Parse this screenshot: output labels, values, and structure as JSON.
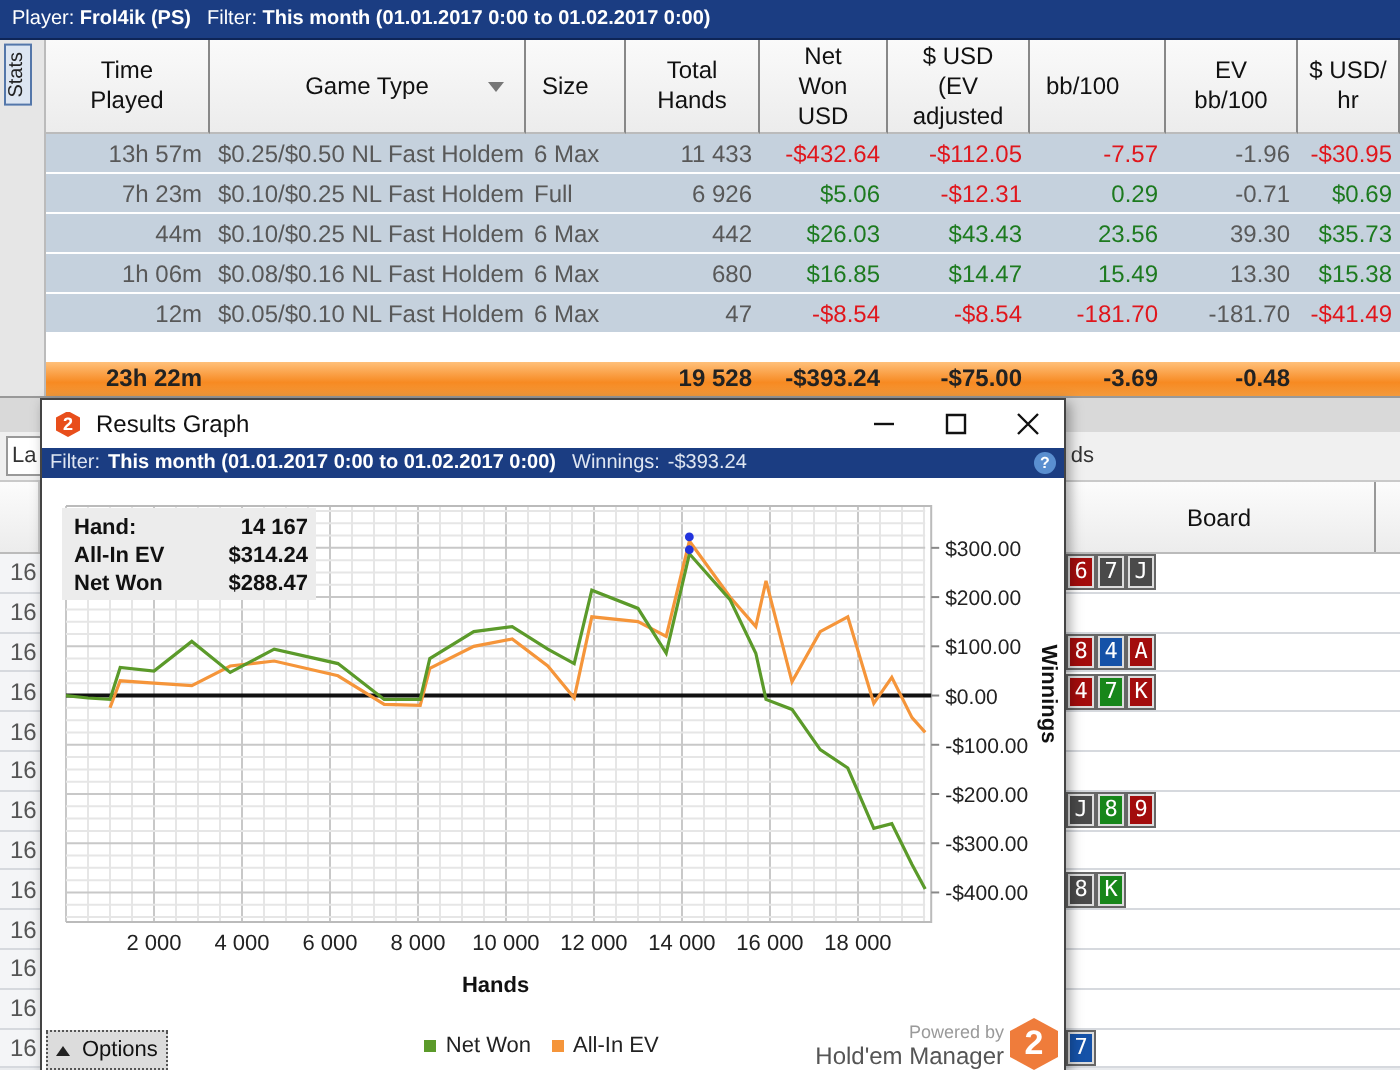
{
  "top_bar": {
    "player_label": "Player:",
    "player": "Frol4ik (PS)",
    "filter_label": "Filter:",
    "filter": "This month (01.01.2017 0:00 to 01.02.2017 0:00)"
  },
  "side_tab": {
    "label": "Stats",
    "selected": true
  },
  "stats_table": {
    "columns": [
      {
        "label": "Time\nPlayed",
        "menu": false
      },
      {
        "label": "Game Type",
        "menu": true
      },
      {
        "label": "Size",
        "menu": false
      },
      {
        "label": "Total\nHands",
        "menu": false
      },
      {
        "label": "Net\nWon\nUSD",
        "menu": false
      },
      {
        "label": "$ USD\n(EV\nadjusted",
        "menu": false
      },
      {
        "label": "bb/100",
        "menu": false
      },
      {
        "label": "EV\nbb/100",
        "menu": false
      },
      {
        "label": "$ USD/\nhr",
        "menu": false
      }
    ],
    "rows": [
      {
        "time": "13h 57m",
        "game_type": "$0.25/$0.50 NL Fast Holdem",
        "size": "6 Max",
        "total_hands": "11 433",
        "metrics": [
          {
            "text": "-$432.64",
            "color": "#e0161c"
          },
          {
            "text": "-$112.05",
            "color": "#e0161c"
          },
          {
            "text": "-7.57",
            "color": "#e0161c"
          },
          {
            "text": "-1.96",
            "color": "#595959"
          },
          {
            "text": "-$30.95",
            "color": "#e0161c"
          }
        ]
      },
      {
        "time": "7h 23m",
        "game_type": "$0.10/$0.25 NL Fast Holdem",
        "size": "Full",
        "total_hands": "6 926",
        "metrics": [
          {
            "text": "$5.06",
            "color": "#1d7a1f"
          },
          {
            "text": "-$12.31",
            "color": "#e0161c"
          },
          {
            "text": "0.29",
            "color": "#1d7a1f"
          },
          {
            "text": "-0.71",
            "color": "#595959"
          },
          {
            "text": "$0.69",
            "color": "#1d7a1f"
          }
        ]
      },
      {
        "time": "44m",
        "game_type": "$0.10/$0.25 NL Fast Holdem",
        "size": "6 Max",
        "total_hands": "442",
        "metrics": [
          {
            "text": "$26.03",
            "color": "#1d7a1f"
          },
          {
            "text": "$43.43",
            "color": "#1d7a1f"
          },
          {
            "text": "23.56",
            "color": "#1d7a1f"
          },
          {
            "text": "39.30",
            "color": "#595959"
          },
          {
            "text": "$35.73",
            "color": "#1d7a1f"
          }
        ]
      },
      {
        "time": "1h 06m",
        "game_type": "$0.08/$0.16 NL Fast Holdem",
        "size": "6 Max",
        "total_hands": "680",
        "metrics": [
          {
            "text": "$16.85",
            "color": "#1d7a1f"
          },
          {
            "text": "$14.47",
            "color": "#1d7a1f"
          },
          {
            "text": "15.49",
            "color": "#1d7a1f"
          },
          {
            "text": "13.30",
            "color": "#595959"
          },
          {
            "text": "$15.38",
            "color": "#1d7a1f"
          }
        ]
      },
      {
        "time": "12m",
        "game_type": "$0.05/$0.10 NL Fast Holdem",
        "size": "6 Max",
        "total_hands": "47",
        "metrics": [
          {
            "text": "-$8.54",
            "color": "#e0161c"
          },
          {
            "text": "-$8.54",
            "color": "#e0161c"
          },
          {
            "text": "-181.70",
            "color": "#e0161c"
          },
          {
            "text": "-181.70",
            "color": "#595959"
          },
          {
            "text": "-$41.49",
            "color": "#e0161c"
          }
        ]
      }
    ],
    "total": {
      "time": "23h 22m",
      "total_hands": "19 528",
      "metrics": [
        "-$393.24",
        "-$75.00",
        "-3.69",
        "-0.48"
      ]
    }
  },
  "lower_panel": {
    "tab_left": "La",
    "tab_right": "ds",
    "board_header": "Board",
    "rows": [
      {
        "label": "16",
        "board": [
          {
            "rank": "6",
            "color": "#a30c0c"
          },
          {
            "rank": "7",
            "color": "#4a4a4a"
          },
          {
            "rank": "J",
            "color": "#4a4a4a"
          }
        ]
      },
      {
        "label": "16",
        "board": []
      },
      {
        "label": "16",
        "board": [
          {
            "rank": "8",
            "color": "#a30c0c"
          },
          {
            "rank": "4",
            "color": "#1552a8"
          },
          {
            "rank": "A",
            "color": "#a30c0c"
          }
        ]
      },
      {
        "label": "16",
        "board": [
          {
            "rank": "4",
            "color": "#a30c0c"
          },
          {
            "rank": "7",
            "color": "#17861a"
          },
          {
            "rank": "K",
            "color": "#a30c0c"
          }
        ]
      },
      {
        "label": "16",
        "board": []
      },
      {
        "label": "16",
        "board": []
      },
      {
        "label": "16",
        "board": [
          {
            "rank": "J",
            "color": "#4a4a4a"
          },
          {
            "rank": "8",
            "color": "#17861a"
          },
          {
            "rank": "9",
            "color": "#a30c0c"
          }
        ]
      },
      {
        "label": "16",
        "board": []
      },
      {
        "label": "16",
        "board": [
          {
            "rank": "8",
            "color": "#4a4a4a"
          },
          {
            "rank": "K",
            "color": "#17861a"
          }
        ]
      },
      {
        "label": "16",
        "board": []
      },
      {
        "label": "16",
        "board": []
      },
      {
        "label": "16",
        "board": []
      },
      {
        "label": "16",
        "board": [
          {
            "rank": "7",
            "color": "#1552a8"
          }
        ]
      }
    ]
  },
  "results_graph": {
    "title": "Results Graph",
    "logo": "2",
    "filter_label": "Filter:",
    "filter": "This month (01.01.2017 0:00 to 01.02.2017 0:00)",
    "winnings_label": "Winnings:",
    "winnings": "-$393.24",
    "help": "?",
    "hover_info": [
      {
        "label": "Hand:",
        "value": "14 167"
      },
      {
        "label": "All-In EV",
        "value": "$314.24"
      },
      {
        "label": "Net Won",
        "value": "$288.47"
      }
    ],
    "chart_data": {
      "type": "line",
      "xlabel": "Hands",
      "ylabel": "Winnings",
      "grid": true,
      "xlim": [
        0,
        19528
      ],
      "ylim": [
        -460,
        385
      ],
      "x": [
        0,
        500,
        1000,
        1230,
        2000,
        2860,
        3730,
        4730,
        6180,
        7230,
        8050,
        8270,
        9270,
        10140,
        10950,
        11550,
        11950,
        13000,
        13640,
        14167,
        15090,
        15680,
        15910,
        16500,
        17140,
        17770,
        18360,
        18770,
        19230,
        19528
      ],
      "series": [
        {
          "name": "Net Won",
          "color": "#5b9a2a",
          "values": [
            0,
            -5,
            -8,
            57,
            50,
            110,
            47,
            94,
            65,
            -8,
            -8,
            75,
            130,
            140,
            94,
            65,
            214,
            177,
            86,
            288,
            195,
            86,
            -8,
            -28,
            -110,
            -147,
            -270,
            -260,
            -343,
            -393
          ]
        },
        {
          "name": "All-In EV",
          "color": "#f5953a",
          "values": [
            null,
            null,
            -25,
            30,
            25,
            20,
            60,
            70,
            40,
            -18,
            -20,
            55,
            100,
            115,
            60,
            -5,
            160,
            150,
            120,
            314,
            200,
            140,
            233,
            28,
            130,
            160,
            -16,
            37,
            -45,
            -75
          ]
        }
      ],
      "xticks": [
        {
          "value": 2000,
          "label": "2 000"
        },
        {
          "value": 4000,
          "label": "4 000"
        },
        {
          "value": 6000,
          "label": "6 000"
        },
        {
          "value": 8000,
          "label": "8 000"
        },
        {
          "value": 10000,
          "label": "10 000"
        },
        {
          "value": 12000,
          "label": "12 000"
        },
        {
          "value": 14000,
          "label": "14 000"
        },
        {
          "value": 16000,
          "label": "16 000"
        },
        {
          "value": 18000,
          "label": "18 000"
        }
      ],
      "yticks": [
        {
          "value": 300,
          "label": "$300.00"
        },
        {
          "value": 200,
          "label": "$200.00"
        },
        {
          "value": 100,
          "label": "$100.00"
        },
        {
          "value": 0,
          "label": "$0.00"
        },
        {
          "value": -100,
          "label": "-$100.00"
        },
        {
          "value": -200,
          "label": "-$200.00"
        },
        {
          "value": -300,
          "label": "-$300.00"
        },
        {
          "value": -400,
          "label": "-$400.00"
        }
      ]
    },
    "hover_marker": true,
    "options_button": "Options",
    "powered_by": "Powered by",
    "brand": "Hold'em Manager",
    "brand_logo": "2"
  }
}
